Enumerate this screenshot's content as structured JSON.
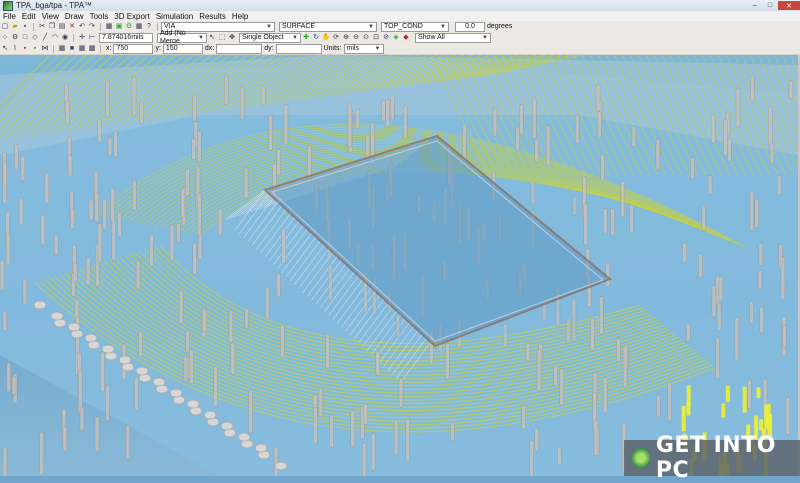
{
  "window": {
    "title": "TPA_bga/tpa - TPA™",
    "controls": [
      "–",
      "□",
      "✕"
    ]
  },
  "menu": {
    "items": [
      "File",
      "Edit",
      "View",
      "Draw",
      "Tools",
      "3D Export",
      "Simulation",
      "Results",
      "Help"
    ]
  },
  "toolbar1": {
    "layer_select": "VIA",
    "surface_select": "SURFACE",
    "conductor_select": "TOP_COND",
    "angle_value": "0.0",
    "angle_unit": "degrees"
  },
  "toolbar2": {
    "mils_value": "7.874016mils",
    "merge_select": "Add (No Merge",
    "selection_mode": "Single Object",
    "filter_select": "Show All"
  },
  "toolbar3": {
    "x_label": "x:",
    "x_value": "750",
    "y_label": "y:",
    "y_value": "150",
    "dx_label": "dx:",
    "dx_value": "",
    "dy_label": "dy:",
    "dy_value": "",
    "units_label": "Units:",
    "units_value": "mils"
  },
  "watermark": {
    "text": "GET INTO PC"
  },
  "colors": {
    "trace": "#c8d23a",
    "board": "#7fb7db",
    "via": "#c7c2bd"
  }
}
